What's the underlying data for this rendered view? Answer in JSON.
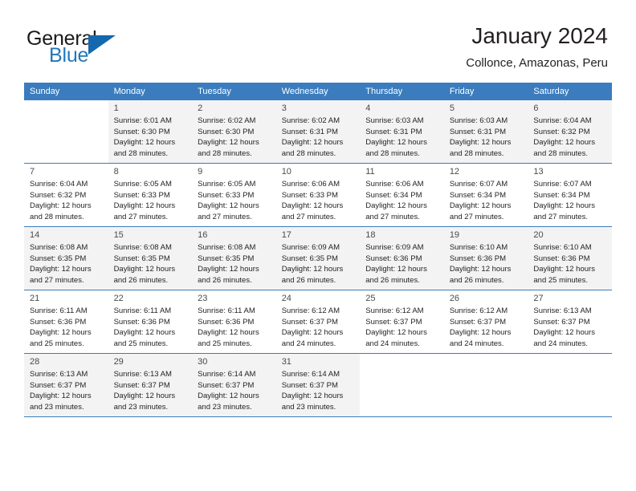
{
  "brand": {
    "name_part1": "General",
    "name_part2": "Blue",
    "triangle_icon": "triangle-icon",
    "accent_color": "#1469ae",
    "text_color": "#2277bb"
  },
  "header": {
    "title": "January 2024",
    "location": "Collonce, Amazonas, Peru"
  },
  "calendar": {
    "header_bg": "#3a7cbe",
    "header_text_color": "#ffffff",
    "alt_row_bg": "#f3f3f3",
    "weekday_headers": [
      "Sunday",
      "Monday",
      "Tuesday",
      "Wednesday",
      "Thursday",
      "Friday",
      "Saturday"
    ],
    "weeks": [
      [
        {
          "day": "",
          "sunrise": "",
          "sunset": "",
          "daylight_line1": "",
          "daylight_line2": ""
        },
        {
          "day": "1",
          "sunrise": "Sunrise: 6:01 AM",
          "sunset": "Sunset: 6:30 PM",
          "daylight_line1": "Daylight: 12 hours",
          "daylight_line2": "and 28 minutes."
        },
        {
          "day": "2",
          "sunrise": "Sunrise: 6:02 AM",
          "sunset": "Sunset: 6:30 PM",
          "daylight_line1": "Daylight: 12 hours",
          "daylight_line2": "and 28 minutes."
        },
        {
          "day": "3",
          "sunrise": "Sunrise: 6:02 AM",
          "sunset": "Sunset: 6:31 PM",
          "daylight_line1": "Daylight: 12 hours",
          "daylight_line2": "and 28 minutes."
        },
        {
          "day": "4",
          "sunrise": "Sunrise: 6:03 AM",
          "sunset": "Sunset: 6:31 PM",
          "daylight_line1": "Daylight: 12 hours",
          "daylight_line2": "and 28 minutes."
        },
        {
          "day": "5",
          "sunrise": "Sunrise: 6:03 AM",
          "sunset": "Sunset: 6:31 PM",
          "daylight_line1": "Daylight: 12 hours",
          "daylight_line2": "and 28 minutes."
        },
        {
          "day": "6",
          "sunrise": "Sunrise: 6:04 AM",
          "sunset": "Sunset: 6:32 PM",
          "daylight_line1": "Daylight: 12 hours",
          "daylight_line2": "and 28 minutes."
        }
      ],
      [
        {
          "day": "7",
          "sunrise": "Sunrise: 6:04 AM",
          "sunset": "Sunset: 6:32 PM",
          "daylight_line1": "Daylight: 12 hours",
          "daylight_line2": "and 28 minutes."
        },
        {
          "day": "8",
          "sunrise": "Sunrise: 6:05 AM",
          "sunset": "Sunset: 6:33 PM",
          "daylight_line1": "Daylight: 12 hours",
          "daylight_line2": "and 27 minutes."
        },
        {
          "day": "9",
          "sunrise": "Sunrise: 6:05 AM",
          "sunset": "Sunset: 6:33 PM",
          "daylight_line1": "Daylight: 12 hours",
          "daylight_line2": "and 27 minutes."
        },
        {
          "day": "10",
          "sunrise": "Sunrise: 6:06 AM",
          "sunset": "Sunset: 6:33 PM",
          "daylight_line1": "Daylight: 12 hours",
          "daylight_line2": "and 27 minutes."
        },
        {
          "day": "11",
          "sunrise": "Sunrise: 6:06 AM",
          "sunset": "Sunset: 6:34 PM",
          "daylight_line1": "Daylight: 12 hours",
          "daylight_line2": "and 27 minutes."
        },
        {
          "day": "12",
          "sunrise": "Sunrise: 6:07 AM",
          "sunset": "Sunset: 6:34 PM",
          "daylight_line1": "Daylight: 12 hours",
          "daylight_line2": "and 27 minutes."
        },
        {
          "day": "13",
          "sunrise": "Sunrise: 6:07 AM",
          "sunset": "Sunset: 6:34 PM",
          "daylight_line1": "Daylight: 12 hours",
          "daylight_line2": "and 27 minutes."
        }
      ],
      [
        {
          "day": "14",
          "sunrise": "Sunrise: 6:08 AM",
          "sunset": "Sunset: 6:35 PM",
          "daylight_line1": "Daylight: 12 hours",
          "daylight_line2": "and 27 minutes."
        },
        {
          "day": "15",
          "sunrise": "Sunrise: 6:08 AM",
          "sunset": "Sunset: 6:35 PM",
          "daylight_line1": "Daylight: 12 hours",
          "daylight_line2": "and 26 minutes."
        },
        {
          "day": "16",
          "sunrise": "Sunrise: 6:08 AM",
          "sunset": "Sunset: 6:35 PM",
          "daylight_line1": "Daylight: 12 hours",
          "daylight_line2": "and 26 minutes."
        },
        {
          "day": "17",
          "sunrise": "Sunrise: 6:09 AM",
          "sunset": "Sunset: 6:35 PM",
          "daylight_line1": "Daylight: 12 hours",
          "daylight_line2": "and 26 minutes."
        },
        {
          "day": "18",
          "sunrise": "Sunrise: 6:09 AM",
          "sunset": "Sunset: 6:36 PM",
          "daylight_line1": "Daylight: 12 hours",
          "daylight_line2": "and 26 minutes."
        },
        {
          "day": "19",
          "sunrise": "Sunrise: 6:10 AM",
          "sunset": "Sunset: 6:36 PM",
          "daylight_line1": "Daylight: 12 hours",
          "daylight_line2": "and 26 minutes."
        },
        {
          "day": "20",
          "sunrise": "Sunrise: 6:10 AM",
          "sunset": "Sunset: 6:36 PM",
          "daylight_line1": "Daylight: 12 hours",
          "daylight_line2": "and 25 minutes."
        }
      ],
      [
        {
          "day": "21",
          "sunrise": "Sunrise: 6:11 AM",
          "sunset": "Sunset: 6:36 PM",
          "daylight_line1": "Daylight: 12 hours",
          "daylight_line2": "and 25 minutes."
        },
        {
          "day": "22",
          "sunrise": "Sunrise: 6:11 AM",
          "sunset": "Sunset: 6:36 PM",
          "daylight_line1": "Daylight: 12 hours",
          "daylight_line2": "and 25 minutes."
        },
        {
          "day": "23",
          "sunrise": "Sunrise: 6:11 AM",
          "sunset": "Sunset: 6:36 PM",
          "daylight_line1": "Daylight: 12 hours",
          "daylight_line2": "and 25 minutes."
        },
        {
          "day": "24",
          "sunrise": "Sunrise: 6:12 AM",
          "sunset": "Sunset: 6:37 PM",
          "daylight_line1": "Daylight: 12 hours",
          "daylight_line2": "and 24 minutes."
        },
        {
          "day": "25",
          "sunrise": "Sunrise: 6:12 AM",
          "sunset": "Sunset: 6:37 PM",
          "daylight_line1": "Daylight: 12 hours",
          "daylight_line2": "and 24 minutes."
        },
        {
          "day": "26",
          "sunrise": "Sunrise: 6:12 AM",
          "sunset": "Sunset: 6:37 PM",
          "daylight_line1": "Daylight: 12 hours",
          "daylight_line2": "and 24 minutes."
        },
        {
          "day": "27",
          "sunrise": "Sunrise: 6:13 AM",
          "sunset": "Sunset: 6:37 PM",
          "daylight_line1": "Daylight: 12 hours",
          "daylight_line2": "and 24 minutes."
        }
      ],
      [
        {
          "day": "28",
          "sunrise": "Sunrise: 6:13 AM",
          "sunset": "Sunset: 6:37 PM",
          "daylight_line1": "Daylight: 12 hours",
          "daylight_line2": "and 23 minutes."
        },
        {
          "day": "29",
          "sunrise": "Sunrise: 6:13 AM",
          "sunset": "Sunset: 6:37 PM",
          "daylight_line1": "Daylight: 12 hours",
          "daylight_line2": "and 23 minutes."
        },
        {
          "day": "30",
          "sunrise": "Sunrise: 6:14 AM",
          "sunset": "Sunset: 6:37 PM",
          "daylight_line1": "Daylight: 12 hours",
          "daylight_line2": "and 23 minutes."
        },
        {
          "day": "31",
          "sunrise": "Sunrise: 6:14 AM",
          "sunset": "Sunset: 6:37 PM",
          "daylight_line1": "Daylight: 12 hours",
          "daylight_line2": "and 23 minutes."
        },
        {
          "day": "",
          "sunrise": "",
          "sunset": "",
          "daylight_line1": "",
          "daylight_line2": ""
        },
        {
          "day": "",
          "sunrise": "",
          "sunset": "",
          "daylight_line1": "",
          "daylight_line2": ""
        },
        {
          "day": "",
          "sunrise": "",
          "sunset": "",
          "daylight_line1": "",
          "daylight_line2": ""
        }
      ]
    ]
  }
}
